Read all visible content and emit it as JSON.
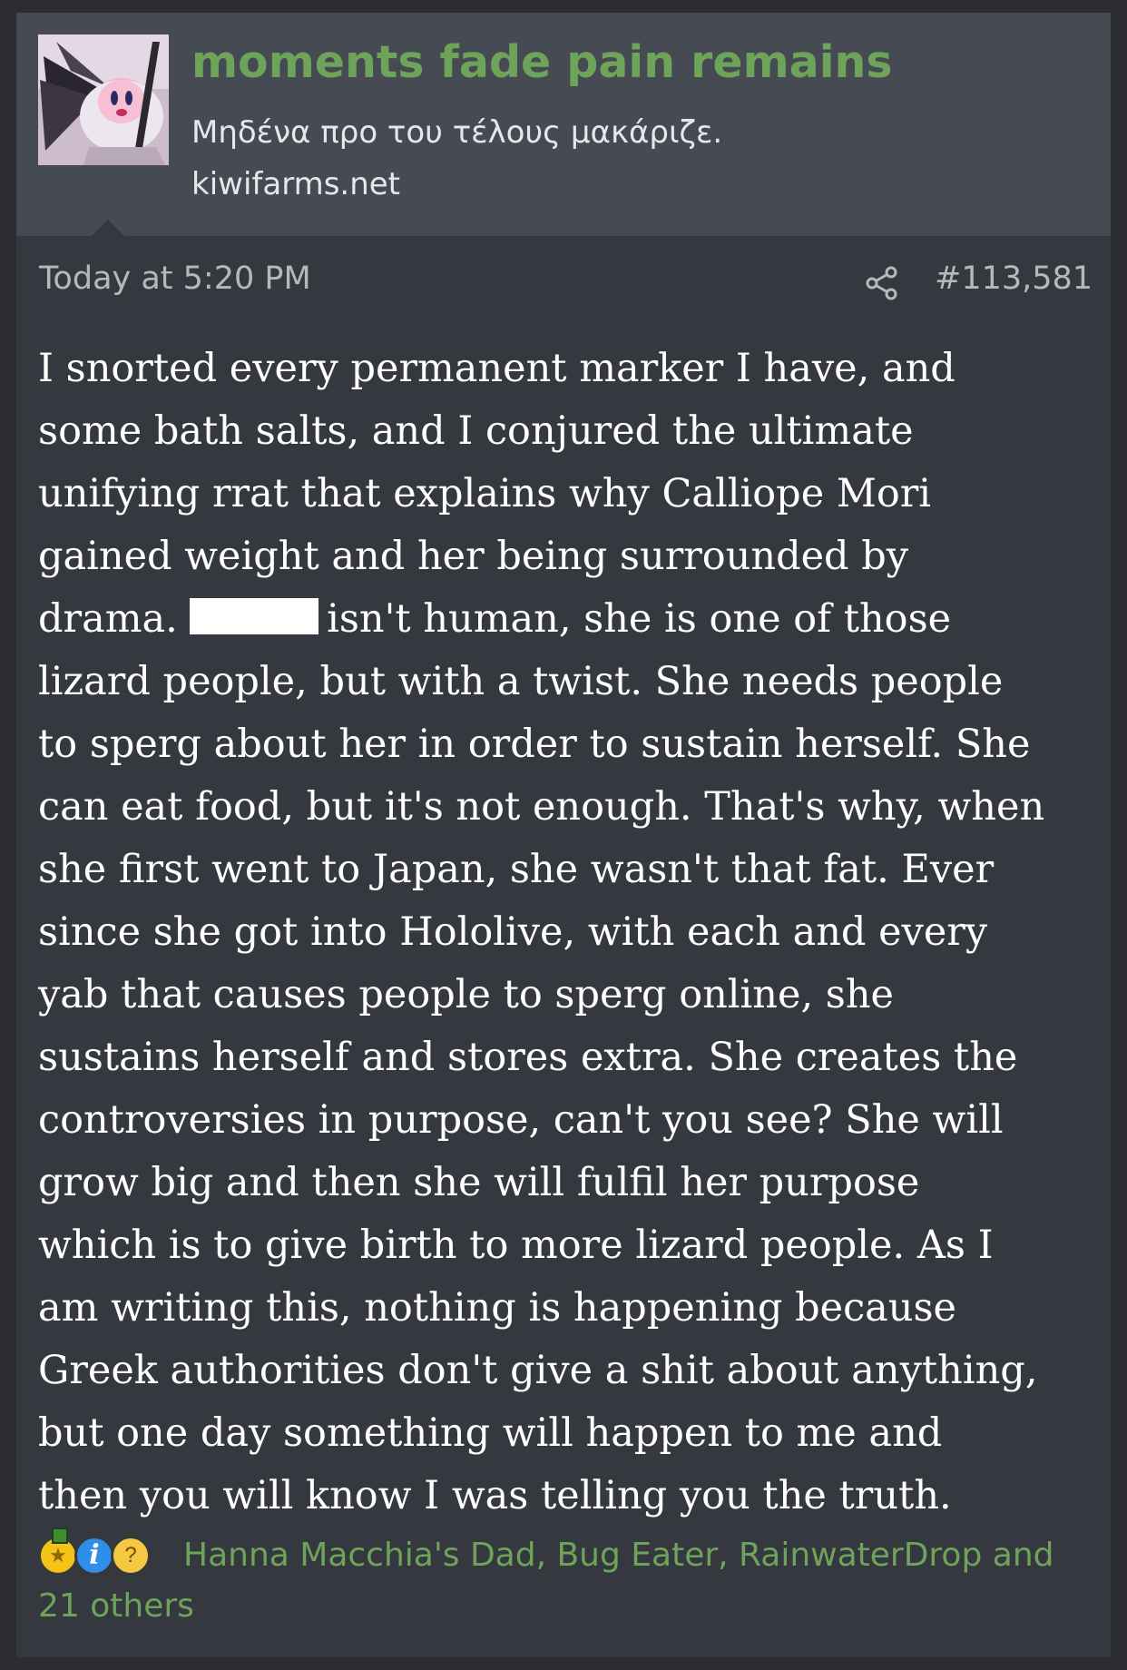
{
  "header": {
    "username": "moments fade pain remains",
    "user_title": "Μηδένα προ του τέλους μακάριζε.",
    "user_site": "kiwifarms.net",
    "avatar_icon": "avatar-image"
  },
  "meta": {
    "date": "Today at 5:20 PM",
    "post_number": "#113,581",
    "share_icon": "share-icon"
  },
  "body": {
    "line_1": "I snorted every permanent marker I have, and",
    "line_2": "some bath salts, and I conjured the ultimate",
    "line_3": "unifying rrat that explains why Calliope Mori",
    "line_4": "gained weight and her being surrounded by",
    "line_5_start": "drama.",
    "line_5_end": "isn't human, she is one of those",
    "line_6": "lizard people, but with a twist. She needs people",
    "line_7": "to sperg about her in order to sustain herself. She",
    "line_8": "can eat food, but it's not enough. That's why, when",
    "line_9": "she first went to Japan, she wasn't that fat. Ever",
    "line_10": "since she got into Hololive, with each and every",
    "line_11": "yab that causes people to sperg online, she",
    "line_12": "sustains herself and stores extra. She creates the",
    "line_13": "controversies in purpose, can't you see? She will",
    "line_14": "grow big and then she will fulfil her purpose",
    "line_15": "which is to give birth to more lizard people. As I",
    "line_16": "am writing this, nothing is happening because",
    "line_17": "Greek authorities don't give a shit about anything,",
    "line_18": "but one day something will happen to me and",
    "line_19": "then you will know I was telling you the truth."
  },
  "reactions": {
    "icons": [
      "medal-icon",
      "info-icon",
      "thinking-icon"
    ],
    "users": "Hanna Macchia's Dad, Bug Eater, RainwaterDrop and 21 others"
  },
  "colors": {
    "page_background": "#2b2d31",
    "post_background": "#35383f",
    "header_background": "#464a52",
    "accent_green": "#6ea35a",
    "body_text": "#ffffff",
    "muted_text": "#b6b8bd"
  }
}
